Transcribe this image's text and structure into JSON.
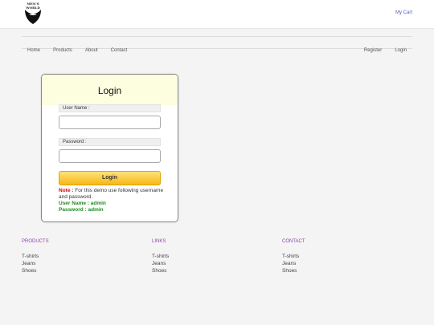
{
  "brand": {
    "logo_text": "MEN'S WORLD"
  },
  "header": {
    "cart_label": "My Cart"
  },
  "nav": {
    "left": [
      "Home",
      "Products",
      "About",
      "Contact"
    ],
    "right": [
      "Register",
      "Login"
    ]
  },
  "login": {
    "title": "Login",
    "username_label": "User Name :",
    "username_value": "",
    "password_label": "Password :",
    "password_value": "",
    "button_label": "Login",
    "note_key": "Note :",
    "note_text": " For this demo use following username and password.",
    "cred_user": "User Name : admin",
    "cred_pass": "Password : admin"
  },
  "footer": {
    "columns": [
      {
        "title": "PRODUCTS",
        "items": [
          "T-shirts",
          "Jeans",
          "Shoes"
        ]
      },
      {
        "title": "LINKS",
        "items": [
          "T-shirts",
          "Jeans",
          "Shoes"
        ]
      },
      {
        "title": "CONTACT",
        "items": [
          "T-shirts",
          "Jeans",
          "Shoes"
        ]
      }
    ]
  },
  "colors": {
    "accent_link": "#4a5fc7",
    "footer_title": "#8e44ad",
    "button": "#f7b715",
    "note_key": "#dd0000",
    "credentials": "#1c8b1c"
  },
  "icons": [
    "beard-logo-icon"
  ]
}
